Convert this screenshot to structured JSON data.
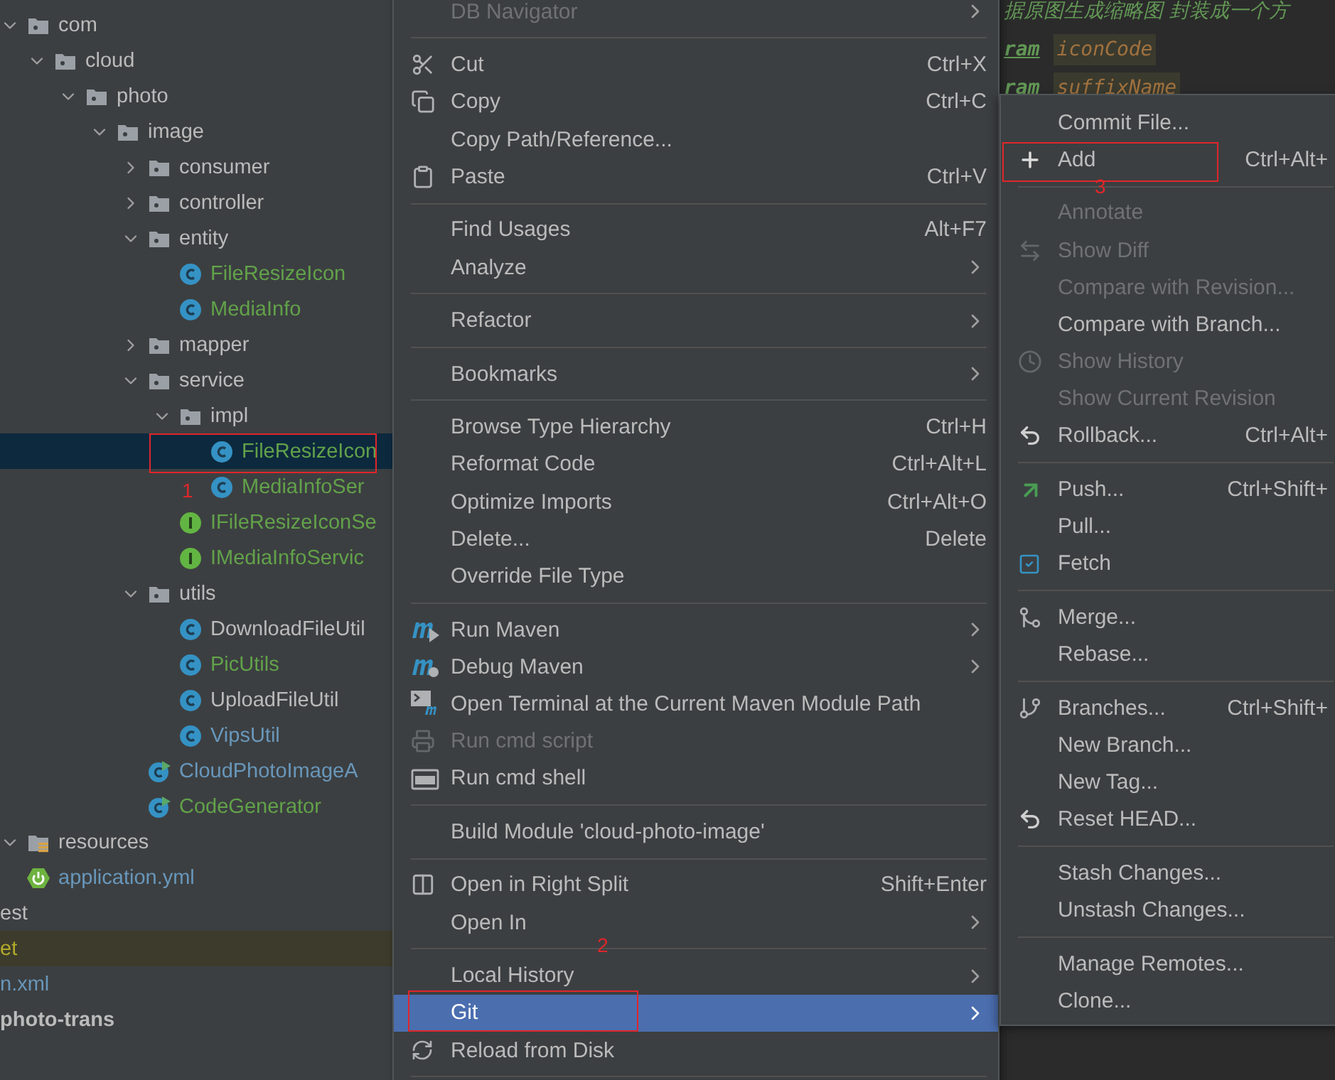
{
  "project_tree": [
    {
      "label": "com",
      "kind": "package",
      "color": "#bbbbbb",
      "selected": false,
      "excluded": false,
      "expanded": true,
      "children": [
        {
          "label": "cloud",
          "kind": "package",
          "color": "#bbbbbb",
          "selected": false,
          "expanded": true,
          "children": [
            {
              "label": "photo",
              "kind": "package",
              "color": "#bbbbbb",
              "selected": false,
              "expanded": true,
              "children": [
                {
                  "label": "image",
                  "kind": "package",
                  "color": "#bbbbbb",
                  "selected": false,
                  "expanded": true,
                  "children": [
                    {
                      "label": "consumer",
                      "kind": "package",
                      "color": "#bbbbbb",
                      "selected": false,
                      "expanded": false
                    },
                    {
                      "label": "controller",
                      "kind": "package",
                      "color": "#bbbbbb",
                      "selected": false,
                      "expanded": false
                    },
                    {
                      "label": "entity",
                      "kind": "package",
                      "color": "#bbbbbb",
                      "selected": false,
                      "expanded": true,
                      "children": [
                        {
                          "label": "FileResizeIcon",
                          "kind": "class",
                          "color": "#62a24a",
                          "selected": false
                        },
                        {
                          "label": "MediaInfo",
                          "kind": "class",
                          "color": "#62a24a",
                          "selected": false
                        }
                      ]
                    },
                    {
                      "label": "mapper",
                      "kind": "package",
                      "color": "#bbbbbb",
                      "selected": false,
                      "expanded": false
                    },
                    {
                      "label": "service",
                      "kind": "package",
                      "color": "#bbbbbb",
                      "selected": false,
                      "expanded": true,
                      "children": [
                        {
                          "label": "impl",
                          "kind": "package",
                          "color": "#bbbbbb",
                          "selected": false,
                          "expanded": true,
                          "children": [
                            {
                              "label": "FileResizeIcon",
                              "kind": "class",
                              "color": "#62a24a",
                              "selected": true
                            },
                            {
                              "label": "MediaInfoSer",
                              "kind": "class",
                              "color": "#62a24a",
                              "selected": false
                            }
                          ]
                        },
                        {
                          "label": "IFileResizeIconSe",
                          "kind": "interface",
                          "color": "#62a24a",
                          "selected": false
                        },
                        {
                          "label": "IMediaInfoServic",
                          "kind": "interface",
                          "color": "#62a24a",
                          "selected": false
                        }
                      ]
                    },
                    {
                      "label": "utils",
                      "kind": "package",
                      "color": "#bbbbbb",
                      "selected": false,
                      "expanded": true,
                      "children": [
                        {
                          "label": "DownloadFileUtil",
                          "kind": "class",
                          "color": "#bbbbbb",
                          "selected": false
                        },
                        {
                          "label": "PicUtils",
                          "kind": "class",
                          "color": "#62a24a",
                          "selected": false
                        },
                        {
                          "label": "UploadFileUtil",
                          "kind": "class",
                          "color": "#bbbbbb",
                          "selected": false
                        },
                        {
                          "label": "VipsUtil",
                          "kind": "class",
                          "color": "#6897bb",
                          "selected": false
                        }
                      ]
                    },
                    {
                      "label": "CloudPhotoImageA",
                      "kind": "main-class",
                      "color": "#6897bb",
                      "selected": false
                    },
                    {
                      "label": "CodeGenerator",
                      "kind": "main-class",
                      "color": "#62a24a",
                      "selected": false
                    }
                  ]
                }
              ]
            }
          ]
        }
      ]
    },
    {
      "label": "resources",
      "kind": "resources",
      "color": "#bbbbbb",
      "selected": false,
      "excluded": false,
      "expanded": true,
      "children": [
        {
          "label": "application.yml",
          "kind": "yml",
          "color": "#6897bb",
          "selected": false
        }
      ]
    },
    {
      "label": "est",
      "kind": "clipped",
      "color": "#bbbbbb",
      "selected": false,
      "excluded": false
    },
    {
      "label": "et",
      "kind": "clipped",
      "color": "#b3ab2b",
      "selected": false,
      "excluded": true
    },
    {
      "label": "n.xml",
      "kind": "clipped",
      "color": "#6897bb",
      "selected": false,
      "excluded": false
    },
    {
      "label": "photo-trans",
      "kind": "clipped-module",
      "color": "#bbbbbb",
      "selected": false,
      "excluded": false
    }
  ],
  "editor_lines": [
    {
      "kind": "comment",
      "text": "据原图生成缩略图   封装成一个方"
    },
    {
      "kind": "param",
      "tag": "ram",
      "name": "iconCode"
    },
    {
      "kind": "param",
      "tag": "ram",
      "name": "suffixName"
    }
  ],
  "context_menu": [
    {
      "kind": "item",
      "label": "DB Navigator",
      "submenu": true,
      "disabled": true,
      "selected": false
    },
    {
      "kind": "separator"
    },
    {
      "kind": "item",
      "label": "Cut",
      "shortcut": "Ctrl+X",
      "submenu": false,
      "disabled": false,
      "selected": false
    },
    {
      "kind": "item",
      "label": "Copy",
      "shortcut": "Ctrl+C",
      "submenu": false,
      "disabled": false,
      "selected": false
    },
    {
      "kind": "item",
      "label": "Copy Path/Reference...",
      "submenu": false,
      "disabled": false,
      "selected": false
    },
    {
      "kind": "item",
      "label": "Paste",
      "shortcut": "Ctrl+V",
      "submenu": false,
      "disabled": false,
      "selected": false
    },
    {
      "kind": "separator"
    },
    {
      "kind": "item",
      "label": "Find Usages",
      "shortcut": "Alt+F7",
      "submenu": false,
      "disabled": false,
      "selected": false
    },
    {
      "kind": "item",
      "label": "Analyze",
      "submenu": true,
      "disabled": false,
      "selected": false
    },
    {
      "kind": "separator"
    },
    {
      "kind": "item",
      "label": "Refactor",
      "submenu": true,
      "disabled": false,
      "selected": false
    },
    {
      "kind": "separator"
    },
    {
      "kind": "item",
      "label": "Bookmarks",
      "submenu": true,
      "disabled": false,
      "selected": false
    },
    {
      "kind": "separator"
    },
    {
      "kind": "item",
      "label": "Browse Type Hierarchy",
      "shortcut": "Ctrl+H",
      "submenu": false,
      "disabled": false,
      "selected": false
    },
    {
      "kind": "item",
      "label": "Reformat Code",
      "shortcut": "Ctrl+Alt+L",
      "submenu": false,
      "disabled": false,
      "selected": false
    },
    {
      "kind": "item",
      "label": "Optimize Imports",
      "shortcut": "Ctrl+Alt+O",
      "submenu": false,
      "disabled": false,
      "selected": false
    },
    {
      "kind": "item",
      "label": "Delete...",
      "shortcut": "Delete",
      "submenu": false,
      "disabled": false,
      "selected": false
    },
    {
      "kind": "item",
      "label": "Override File Type",
      "submenu": false,
      "disabled": false,
      "selected": false
    },
    {
      "kind": "separator"
    },
    {
      "kind": "item",
      "label": "Run Maven",
      "submenu": true,
      "disabled": false,
      "selected": false
    },
    {
      "kind": "item",
      "label": "Debug Maven",
      "submenu": true,
      "disabled": false,
      "selected": false
    },
    {
      "kind": "item",
      "label": "Open Terminal at the Current Maven Module Path",
      "submenu": false,
      "disabled": false,
      "selected": false
    },
    {
      "kind": "item",
      "label": "Run cmd script",
      "submenu": false,
      "disabled": true,
      "selected": false
    },
    {
      "kind": "item",
      "label": "Run cmd shell",
      "submenu": false,
      "disabled": false,
      "selected": false
    },
    {
      "kind": "separator"
    },
    {
      "kind": "item",
      "label": "Build Module 'cloud-photo-image'",
      "submenu": false,
      "disabled": false,
      "selected": false
    },
    {
      "kind": "separator"
    },
    {
      "kind": "item",
      "label": "Open in Right Split",
      "shortcut": "Shift+Enter",
      "submenu": false,
      "disabled": false,
      "selected": false
    },
    {
      "kind": "item",
      "label": "Open In",
      "submenu": true,
      "disabled": false,
      "selected": false
    },
    {
      "kind": "separator"
    },
    {
      "kind": "item",
      "label": "Local History",
      "submenu": true,
      "disabled": false,
      "selected": false
    },
    {
      "kind": "item",
      "label": "Git",
      "submenu": true,
      "disabled": false,
      "selected": true
    },
    {
      "kind": "item",
      "label": "Reload from Disk",
      "submenu": false,
      "disabled": false,
      "selected": false
    },
    {
      "kind": "separator"
    }
  ],
  "git_submenu": [
    {
      "kind": "item",
      "label": "Commit File...",
      "disabled": false,
      "selected": false
    },
    {
      "kind": "item",
      "label": "Add",
      "shortcut": "Ctrl+Alt+",
      "disabled": false,
      "selected": false
    },
    {
      "kind": "separator"
    },
    {
      "kind": "item",
      "label": "Annotate",
      "disabled": true,
      "selected": false
    },
    {
      "kind": "item",
      "label": "Show Diff",
      "disabled": true,
      "selected": false
    },
    {
      "kind": "item",
      "label": "Compare with Revision...",
      "disabled": true,
      "selected": false
    },
    {
      "kind": "item",
      "label": "Compare with Branch...",
      "disabled": false,
      "selected": false
    },
    {
      "kind": "item",
      "label": "Show History",
      "disabled": true,
      "selected": false
    },
    {
      "kind": "item",
      "label": "Show Current Revision",
      "disabled": true,
      "selected": false
    },
    {
      "kind": "item",
      "label": "Rollback...",
      "shortcut": "Ctrl+Alt+",
      "disabled": false,
      "selected": false
    },
    {
      "kind": "separator"
    },
    {
      "kind": "item",
      "label": "Push...",
      "shortcut": "Ctrl+Shift+",
      "disabled": false,
      "selected": false
    },
    {
      "kind": "item",
      "label": "Pull...",
      "disabled": false,
      "selected": false
    },
    {
      "kind": "item",
      "label": "Fetch",
      "disabled": false,
      "selected": false
    },
    {
      "kind": "separator"
    },
    {
      "kind": "item",
      "label": "Merge...",
      "disabled": false,
      "selected": false
    },
    {
      "kind": "item",
      "label": "Rebase...",
      "disabled": false,
      "selected": false
    },
    {
      "kind": "separator"
    },
    {
      "kind": "item",
      "label": "Branches...",
      "shortcut": "Ctrl+Shift+",
      "disabled": false,
      "selected": false
    },
    {
      "kind": "item",
      "label": "New Branch...",
      "disabled": false,
      "selected": false
    },
    {
      "kind": "item",
      "label": "New Tag...",
      "disabled": false,
      "selected": false
    },
    {
      "kind": "item",
      "label": "Reset HEAD...",
      "disabled": false,
      "selected": false
    },
    {
      "kind": "separator"
    },
    {
      "kind": "item",
      "label": "Stash Changes...",
      "disabled": false,
      "selected": false
    },
    {
      "kind": "item",
      "label": "Unstash Changes...",
      "disabled": false,
      "selected": false
    },
    {
      "kind": "separator"
    },
    {
      "kind": "item",
      "label": "Manage Remotes...",
      "disabled": false,
      "selected": false
    },
    {
      "kind": "item",
      "label": "Clone...",
      "disabled": false,
      "selected": false
    }
  ],
  "annotations": [
    {
      "label": "1"
    },
    {
      "label": "2"
    },
    {
      "label": "3"
    }
  ]
}
